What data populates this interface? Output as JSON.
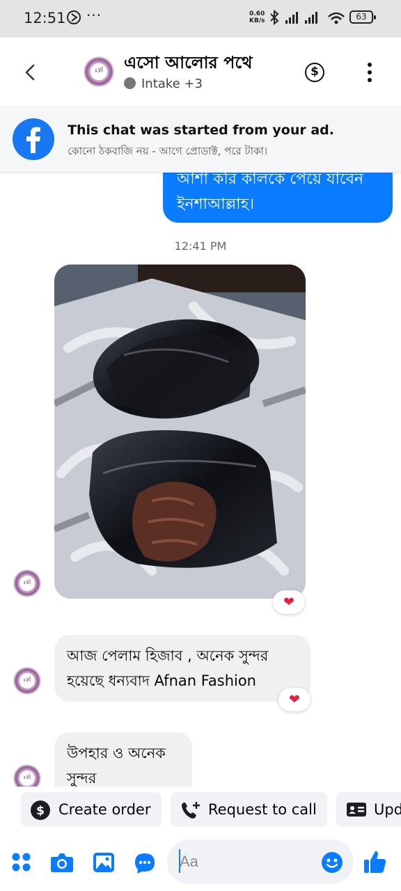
{
  "status_bar": {
    "time": "12:51",
    "more": "···",
    "net_speed": "0.60",
    "net_unit": "KB/s",
    "battery": "63"
  },
  "header": {
    "title": "এসো আলোর পথে",
    "subtitle": "Intake +3",
    "avatar_text": "آلاء"
  },
  "ad_banner": {
    "title": "This chat was started from your ad.",
    "subtitle": "কোনো ঠকবাজি নয় - আগে প্রোডাক্ট, পরে টাকা।"
  },
  "messages": {
    "outgoing_text": "আশা করি কালকে পেয়ে যাবেন ইনশাআল্লাহ।",
    "timestamp": "12:41 PM",
    "incoming": [
      {
        "text": "আজ পেলাম হিজাব , অনেক সুন্দর হয়েছে ধন্যবাদ Afnan Fashion",
        "reaction": "❤"
      },
      {
        "text": "উপহার ও অনেক সুন্দর"
      }
    ],
    "photo_reaction": "❤"
  },
  "quick_actions": [
    {
      "label": "Create order",
      "icon": "dollar-circle-icon"
    },
    {
      "label": "Request to call",
      "icon": "phone-plus-icon"
    },
    {
      "label": "Upd",
      "icon": "contact-card-icon"
    }
  ],
  "composer": {
    "placeholder": "Aa"
  },
  "colors": {
    "messenger_blue": "#0a7cff",
    "facebook_blue": "#1877f2",
    "heart_red": "#e81d3f"
  }
}
